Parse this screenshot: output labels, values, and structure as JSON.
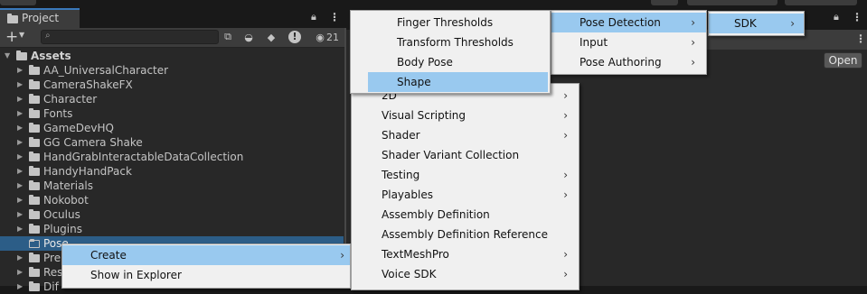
{
  "project_panel": {
    "tab_label": "Project",
    "hidden_count": "21",
    "search": {
      "placeholder": "",
      "value": ""
    },
    "tree": {
      "root": "Assets",
      "folders": [
        "AA_UniversalCharacter",
        "CameraShakeFX",
        "Character",
        "Fonts",
        "GameDevHQ",
        "GG Camera Shake",
        "HandGrabInteractableDataCollection",
        "HandyHandPack",
        "Materials",
        "Nokobot",
        "Oculus",
        "Plugins",
        "Pose",
        "Pre",
        "Res",
        "Dif"
      ]
    }
  },
  "inspector": {
    "open_label": "Open"
  },
  "context_menu": {
    "items": [
      {
        "label": "Create",
        "has_submenu": true,
        "highlighted": true
      },
      {
        "label": "Show in Explorer",
        "has_submenu": false,
        "highlighted": false
      }
    ]
  },
  "create_menu": {
    "items": [
      {
        "label": "2D",
        "has_submenu": true
      },
      {
        "label": "Visual Scripting",
        "has_submenu": true
      },
      {
        "label": "Shader",
        "has_submenu": true
      },
      {
        "label": "Shader Variant Collection",
        "has_submenu": false
      },
      {
        "label": "Testing",
        "has_submenu": true
      },
      {
        "label": "Playables",
        "has_submenu": true
      },
      {
        "label": "Assembly Definition",
        "has_submenu": false
      },
      {
        "label": "Assembly Definition Reference",
        "has_submenu": false
      },
      {
        "label": "TextMeshPro",
        "has_submenu": true
      },
      {
        "label": "Voice SDK",
        "has_submenu": true
      }
    ]
  },
  "sdk_menu": {
    "items": [
      {
        "label": "SDK",
        "has_submenu": true,
        "highlighted": true
      }
    ]
  },
  "sdk_submenu": {
    "items": [
      {
        "label": "Pose Detection",
        "has_submenu": true,
        "highlighted": true
      },
      {
        "label": "Input",
        "has_submenu": true,
        "highlighted": false
      },
      {
        "label": "Pose Authoring",
        "has_submenu": true,
        "highlighted": false
      }
    ]
  },
  "pose_detection_menu": {
    "items": [
      {
        "label": "Finger Thresholds",
        "highlighted": false
      },
      {
        "label": "Transform Thresholds",
        "highlighted": false
      },
      {
        "label": "Body Pose",
        "highlighted": false
      },
      {
        "label": "Shape",
        "highlighted": true
      }
    ]
  },
  "colors": {
    "menu_background": "#f0f0f0",
    "menu_highlight": "#99c9ef",
    "selection_blue": "#2c5d87",
    "panel_background": "#282828"
  }
}
